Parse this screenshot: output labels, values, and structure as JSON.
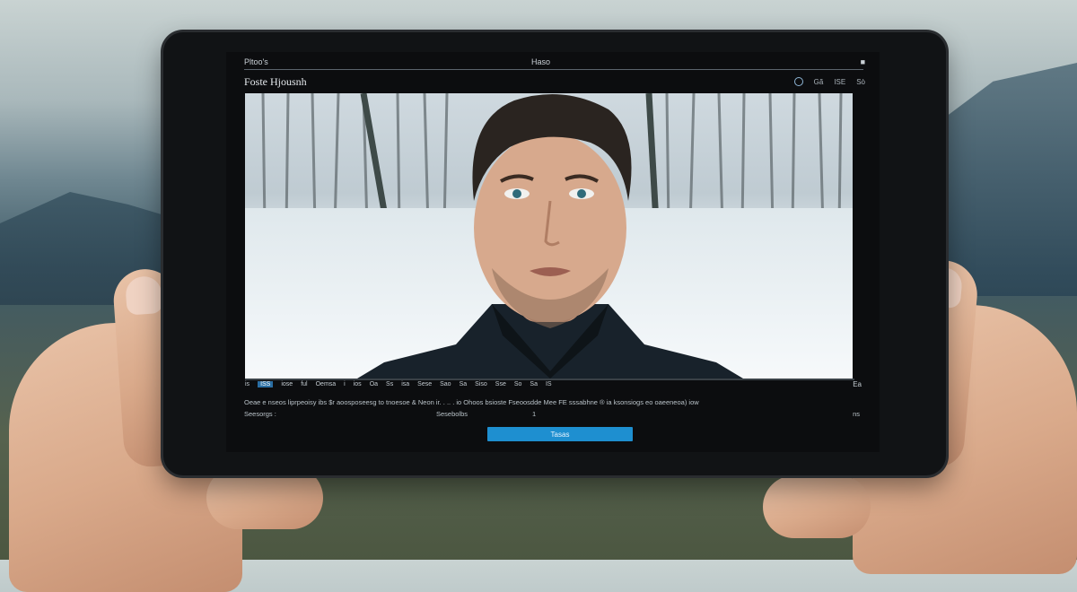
{
  "screen": {
    "topbar": {
      "left_text": "Pltoo's",
      "center_text": "Haso",
      "right_text": "■"
    },
    "title": "Foste Hjousnh",
    "title_icons": [
      "◎",
      "Gã",
      "ISE",
      "Sò"
    ],
    "player": {
      "controls": [
        "is",
        "ISS",
        "iose",
        "ful",
        "Oemsa",
        "i",
        "ios",
        "Oa",
        "Ss",
        "isa",
        "Sese",
        "Sao",
        "Sa",
        "Siso",
        "Sse",
        "So",
        "Sa",
        "IS"
      ],
      "active_control_index": 1,
      "timecode": "Ea",
      "progress": 0.0
    },
    "caption_line1": "Oeae e nseos liprpeoisy ibs $r aoosposeesg to tnoesoe & Neon ir. . .. . io Ohoos bsioste Fseoosdde Mee FE sssabhne ® ia ksonsiogs eo oaeeneoa) iow",
    "meta": {
      "left": "Seesorgs :",
      "mid": "Sesebolbs",
      "mid2": "1",
      "right": "ns"
    },
    "button_label": "Tasas"
  },
  "colors": {
    "accent": "#1e8fd0",
    "bezel": "#111315",
    "screen_bg": "#0c0d0f"
  }
}
